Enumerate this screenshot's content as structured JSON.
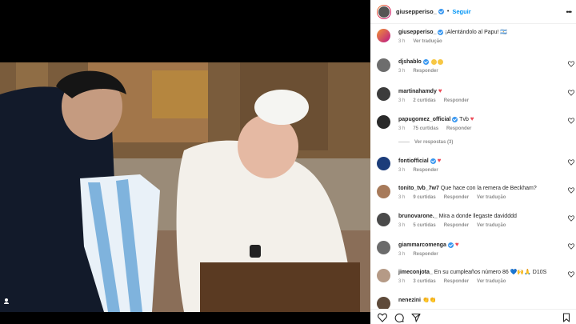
{
  "post": {
    "username": "giusepperiso_",
    "follow_label": "Seguir",
    "separator": "•",
    "caption_text": "¡Alentándolo al Papu! 🇦🇷",
    "caption_time": "3 h",
    "caption_translate": "Ver tradução",
    "more": "•••"
  },
  "comments": [
    {
      "user": "djshablo",
      "text": "",
      "emojis": 2,
      "time": "3 h",
      "likes": "",
      "reply": "Responder"
    },
    {
      "user": "martinahamdy",
      "text": "",
      "heart": true,
      "time": "3 h",
      "likes": "2 curtidas",
      "reply": "Responder"
    },
    {
      "user": "papugomez_official",
      "text": "Tvb",
      "heart": true,
      "time": "3 h",
      "likes": "75 curtidas",
      "reply": "Responder"
    },
    {
      "user": "fontiofficial",
      "text": "",
      "heart": true,
      "time": "3 h",
      "likes": "",
      "reply": "Responder"
    },
    {
      "user": "tonito_tvb_7w7",
      "text": "Que hace con la remera de Beckham?",
      "time": "3 h",
      "likes": "9 curtidas",
      "reply": "Responder",
      "translate": "Ver tradução"
    },
    {
      "user": "brunovarone._",
      "text": "Mira a donde llegaste davidddd",
      "time": "3 h",
      "likes": "5 curtidas",
      "reply": "Responder",
      "translate": "Ver tradução"
    },
    {
      "user": "giammarcomenga",
      "text": "",
      "heart": true,
      "time": "3 h",
      "likes": "",
      "reply": "Responder"
    },
    {
      "user": "jimeconjota_",
      "text": "En su cumpleaños número 86 💙🙌🙏 D10S",
      "time": "3 h",
      "likes": "3 curtidas",
      "reply": "Responder",
      "translate": "Ver tradução"
    },
    {
      "user": "nenezini",
      "text": "👏👏",
      "time": "",
      "likes": "",
      "reply": ""
    }
  ],
  "view_replies": "Ver respostas (3)",
  "colors": {
    "accent": "#0095f6",
    "verified": "#3897f0",
    "heart": "#ed4956"
  }
}
